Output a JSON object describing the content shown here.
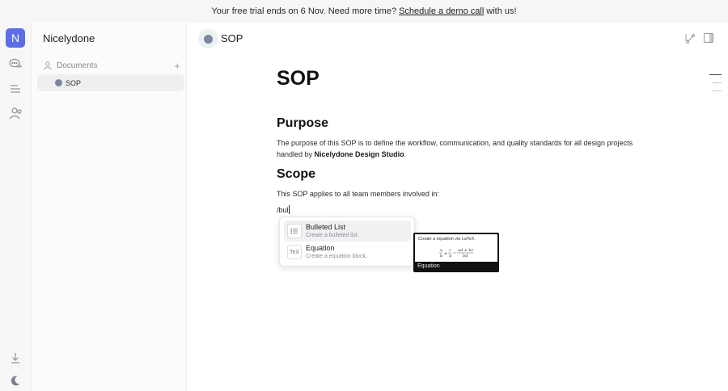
{
  "banner": {
    "prefix": "Your free trial ends on 6 Nov. Need more time?",
    "link": "Schedule a demo call",
    "suffix": "with us!"
  },
  "rail": {
    "workspace_initial": "N",
    "icons": [
      "chat-icon",
      "outline-icon",
      "members-icon",
      "download-icon",
      "moon-icon"
    ]
  },
  "sidebar": {
    "workspace_name": "Nicelydone",
    "section_label": "Documents",
    "pages": [
      {
        "label": "SOP"
      }
    ]
  },
  "topbar": {
    "title": "SOP",
    "icons": [
      "history-icon",
      "panel-toggle-icon"
    ]
  },
  "document": {
    "title": "SOP",
    "sections": [
      {
        "heading": "Purpose",
        "text_before": "The purpose of this SOP is to define the workflow, communication, and quality standards for all design projects handled by ",
        "bold": "Nicelydone Design Studio",
        "text_after": "."
      },
      {
        "heading": "Scope",
        "text": "This SOP applies to all team members involved in:"
      }
    ],
    "command_input": "/bul"
  },
  "slash_menu": {
    "items": [
      {
        "title": "Bulleted List",
        "description": "Create a bulleted list.",
        "icon": "list-icon"
      },
      {
        "title": "Equation",
        "description": "Create a equation block.",
        "icon": "tex-icon",
        "icon_text": "TeX"
      }
    ]
  },
  "preview": {
    "caption": "Create a equation via LaTeX.",
    "label": "Equation"
  },
  "colors": {
    "accent": "#5c6ee6",
    "page_dot": "#7b87a0"
  }
}
